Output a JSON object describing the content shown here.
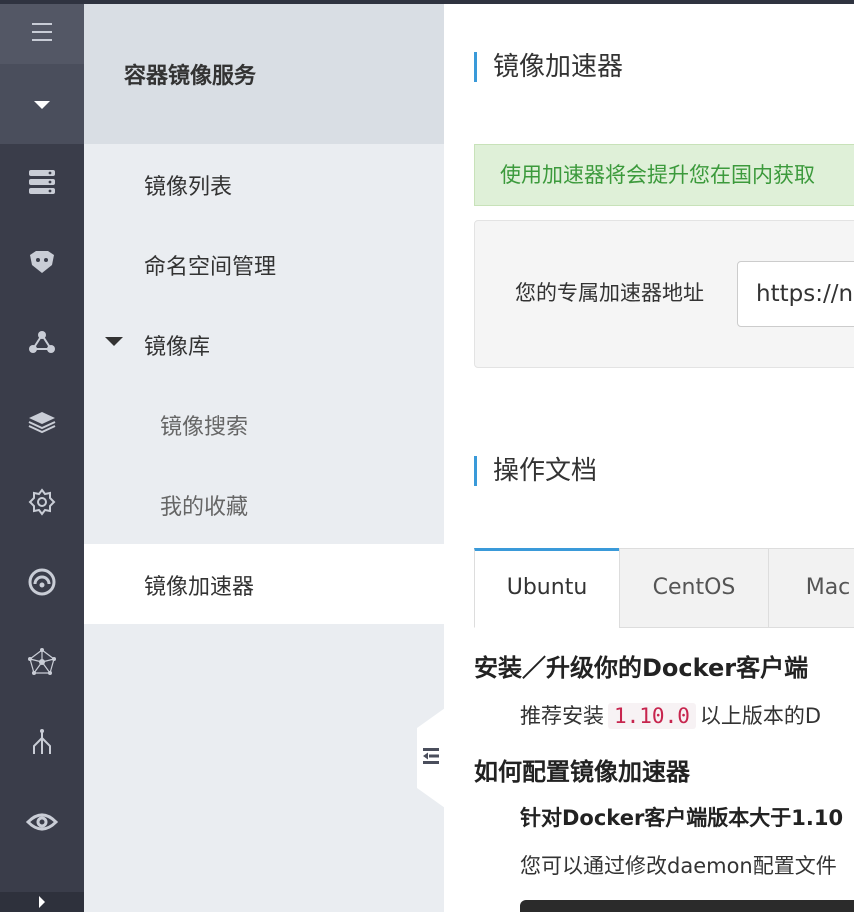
{
  "rail": {
    "items": [
      {
        "icon": "server-icon"
      },
      {
        "icon": "container-icon"
      },
      {
        "icon": "cluster-icon"
      },
      {
        "icon": "layers-icon"
      },
      {
        "icon": "gear-icon"
      },
      {
        "icon": "signal-icon"
      },
      {
        "icon": "network-icon"
      },
      {
        "icon": "branch-icon"
      },
      {
        "icon": "eye-icon"
      }
    ]
  },
  "subnav": {
    "title": "容器镜像服务",
    "items": [
      {
        "label": "镜像列表"
      },
      {
        "label": "命名空间管理"
      },
      {
        "label": "镜像库"
      },
      {
        "label": "镜像搜索"
      },
      {
        "label": "我的收藏"
      },
      {
        "label": "镜像加速器"
      }
    ],
    "active": "镜像加速器"
  },
  "main": {
    "section1_title": "镜像加速器",
    "alert_text": "使用加速器将会提升您在国内获取",
    "addr_label": "您的专属加速器地址",
    "addr_value": "https://n",
    "section2_title": "操作文档",
    "tabs": [
      {
        "label": "Ubuntu"
      },
      {
        "label": "CentOS"
      },
      {
        "label": "Mac"
      }
    ],
    "active_tab": "Ubuntu",
    "doc": {
      "h1": "安装／升级你的Docker客户端",
      "p1_before": "推荐安装",
      "p1_code": "1.10.0",
      "p1_after": "以上版本的D",
      "h2": "如何配置镜像加速器",
      "sub1": "针对Docker客户端版本大于1.10",
      "p2": "您可以通过修改daemon配置文件"
    }
  },
  "colors": {
    "rail_bg": "#3a3d4a",
    "subnav_bg": "#eaedf1",
    "accent": "#3a9ad9",
    "alert_bg": "#dff0d8",
    "alert_text": "#3c9a3c",
    "code_text": "#c7254e"
  }
}
